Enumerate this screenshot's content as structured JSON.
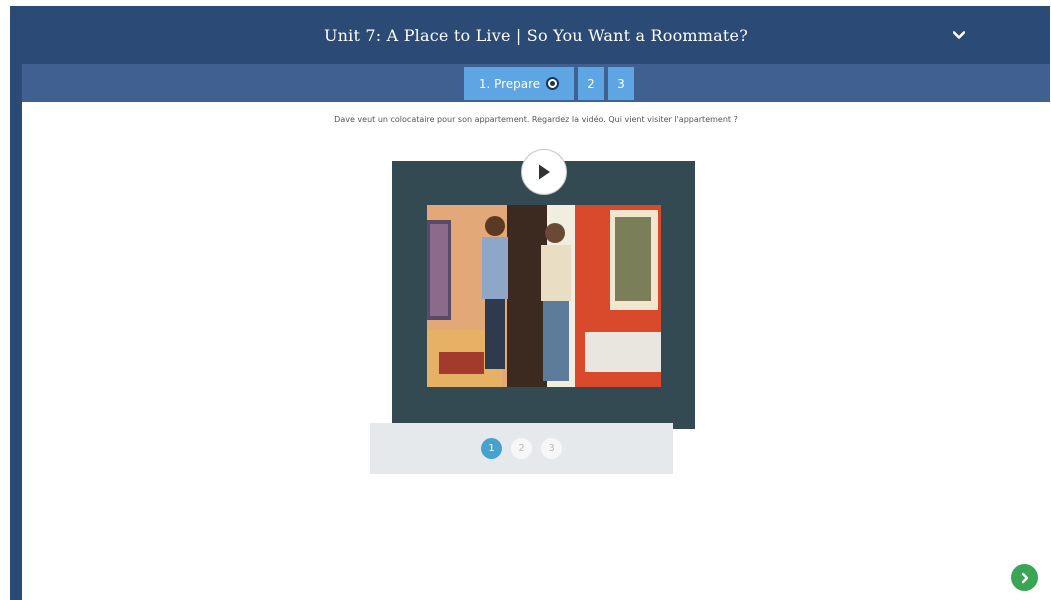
{
  "header": {
    "title": "Unit 7: A Place to Live | So You Want a Roommate?",
    "collapse_icon": "chevron-down-icon"
  },
  "steps": {
    "items": [
      {
        "label": "1. Prepare",
        "active": true
      },
      {
        "label": "2",
        "active": false
      },
      {
        "label": "3",
        "active": false
      }
    ]
  },
  "instruction": "Dave veut un colocataire pour son appartement. Regardez la vidéo. Qui vient visiter l'appartement ?",
  "video": {
    "play_icon": "play-icon",
    "thumbnail": "two-men-at-apartment-door"
  },
  "pager": {
    "pages": [
      {
        "label": "1",
        "active": true
      },
      {
        "label": "2",
        "active": false
      },
      {
        "label": "3",
        "active": false
      }
    ]
  },
  "navigation": {
    "next_icon": "chevron-right-icon"
  },
  "colors": {
    "header_bg": "#2c4a76",
    "step_bar_bg": "#3f6090",
    "step_bg": "#5ea6e3",
    "video_card_bg": "#344a53",
    "pager_bg": "#e6e9eb",
    "active_page": "#45a2cf",
    "next_button": "#3aa555"
  }
}
